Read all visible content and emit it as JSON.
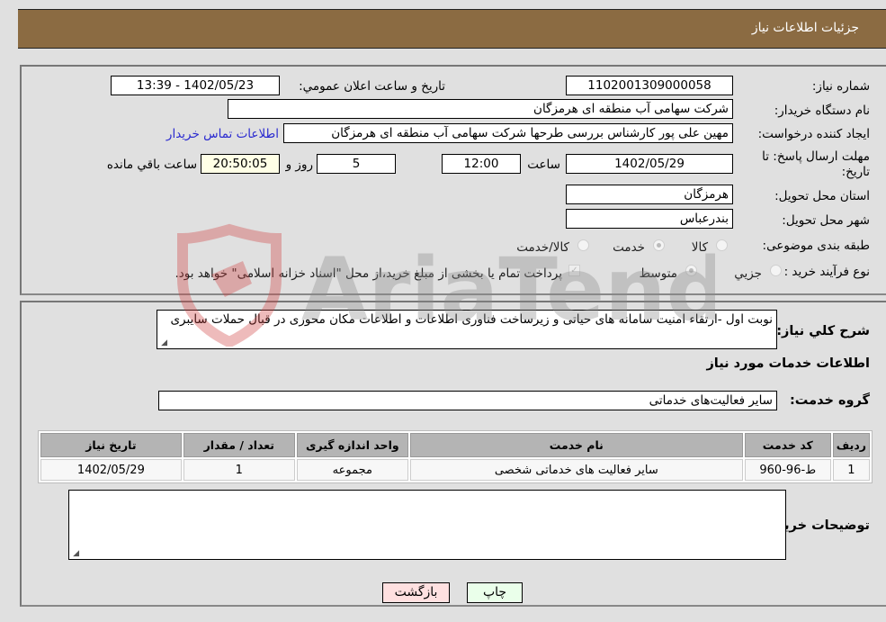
{
  "header": {
    "title": "جزئیات اطلاعات نیاز"
  },
  "form": {
    "need_number_label": "شماره نیاز:",
    "need_number": "1102001309000058",
    "announce_label": "تاریخ و ساعت اعلان عمومي:",
    "announce_value": "1402/05/23 - 13:39",
    "buyer_label": "نام دستگاه خریدار:",
    "buyer_value": "شرکت سهامی  آب منطقه ای هرمزگان",
    "creator_label": "ایجاد کننده درخواست:",
    "creator_value": "مهین علی پور کارشناس بررسی طرحها شرکت سهامی  آب منطقه ای هرمزگان",
    "contact_link": "اطلاعات تماس خریدار",
    "deadline_label": "مهلت ارسال پاسخ: تا تاریخ:",
    "deadline_date": "1402/05/29",
    "time_label": "ساعت",
    "deadline_time": "12:00",
    "days_value": "5",
    "days_label": "روز و",
    "remaining_time": "20:50:05",
    "remaining_label": "ساعت باقي مانده",
    "province_label": "استان محل تحویل:",
    "province_value": "هرمزگان",
    "city_label": "شهر محل تحویل:",
    "city_value": "بندرعباس",
    "category_label": "طبقه بندی موضوعی:",
    "category_options": [
      {
        "label": "کالا",
        "checked": false
      },
      {
        "label": "خدمت",
        "checked": true
      },
      {
        "label": "کالا/خدمت",
        "checked": false
      }
    ],
    "process_label": "نوع فرآیند خرید :",
    "process_options": [
      {
        "label": "جزيي",
        "checked": false
      },
      {
        "label": "متوسط",
        "checked": true
      }
    ],
    "treasury_checkbox_label": "پرداخت تمام یا بخشی از مبلغ خرید،از محل \"اسناد خزانه اسلامی\" خواهد بود.",
    "treasury_checked": true
  },
  "details": {
    "description_label": "شرح کلي نياز:",
    "description_value": "نوبت اول -ارتقاء امنیت سامانه های حیاتی و زیرساخت فناوری اطلاعات و اطلاعات مکان محوری در قبال حملات سایبری",
    "services_heading": "اطلاعات خدمات مورد نياز",
    "service_group_label": "گروه خدمت:",
    "service_group_value": "سایر فعالیت‌های خدماتی",
    "table": {
      "headers": [
        "رديف",
        "كد خدمت",
        "نام خدمت",
        "واحد اندازه گیری",
        "تعداد / مقدار",
        "تاریخ نیاز"
      ],
      "rows": [
        [
          "1",
          "ط-96-960",
          "سایر فعالیت های خدماتی شخصی",
          "مجموعه",
          "1",
          "1402/05/29"
        ]
      ]
    },
    "buyer_notes_label": "توضيحات خريدار:",
    "buyer_notes_value": ""
  },
  "buttons": {
    "print": "چاپ",
    "back": "بازگشت"
  },
  "watermark": {
    "text": "AriaTender.neT"
  }
}
